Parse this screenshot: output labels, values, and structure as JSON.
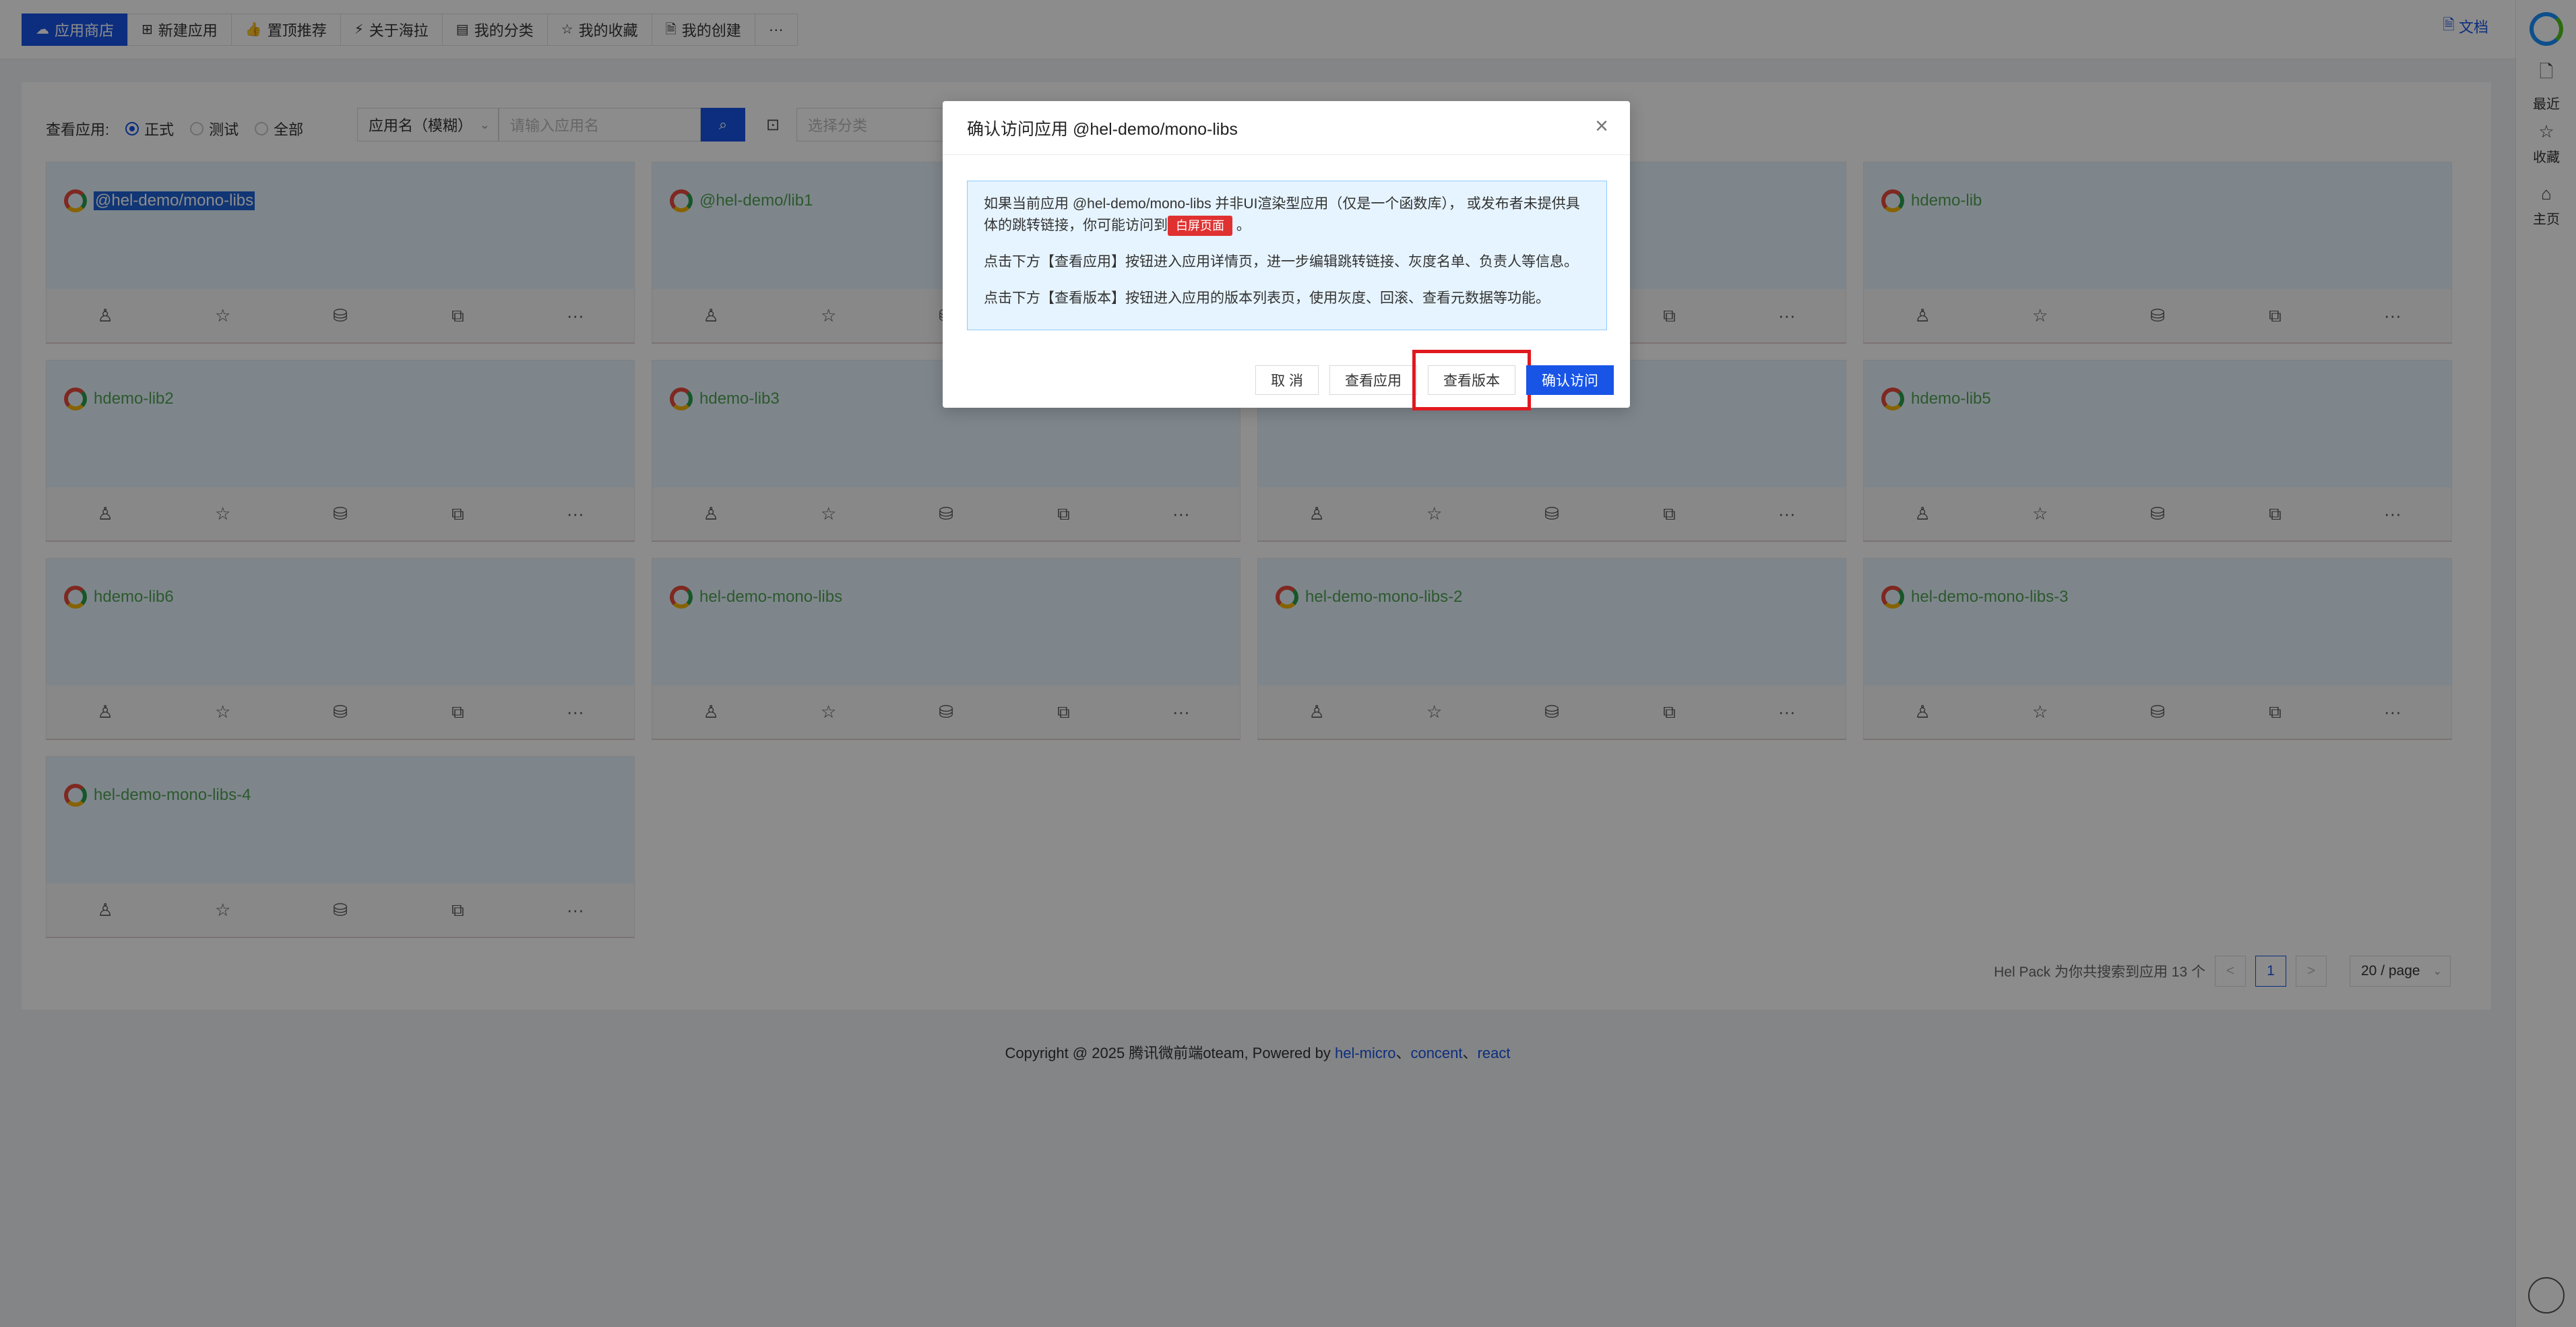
{
  "topnav": {
    "items": [
      {
        "label": "应用商店",
        "icon": "cloud-icon",
        "glyph": "☁",
        "active": true
      },
      {
        "label": "新建应用",
        "icon": "plus-square-icon",
        "glyph": "⊞"
      },
      {
        "label": "置顶推荐",
        "icon": "thumbs-up-icon",
        "glyph": "👍"
      },
      {
        "label": "关于海拉",
        "icon": "lightning-icon",
        "glyph": "⚡"
      },
      {
        "label": "我的分类",
        "icon": "list-icon",
        "glyph": "▤"
      },
      {
        "label": "我的收藏",
        "icon": "star-icon",
        "glyph": "☆"
      },
      {
        "label": "我的创建",
        "icon": "file-icon",
        "glyph": "🗎"
      },
      {
        "label": "···",
        "icon": "more-icon",
        "glyph": ""
      }
    ],
    "doc_label": "文档"
  },
  "right_sidebar": {
    "items": [
      {
        "label": "最近",
        "icon": "file-icon",
        "glyph": "🗋"
      },
      {
        "label": "收藏",
        "icon": "star-icon",
        "glyph": "☆"
      },
      {
        "label": "主页",
        "icon": "home-icon",
        "glyph": "⌂"
      }
    ]
  },
  "filters": {
    "label": "查看应用:",
    "options": [
      "正式",
      "测试",
      "全部"
    ],
    "selected": "正式",
    "type_select": "应用名（模糊）",
    "search_placeholder": "请输入应用名",
    "category_placeholder": "选择分类"
  },
  "cards": [
    {
      "name": "@hel-demo/mono-libs",
      "selected": true
    },
    {
      "name": "@hel-demo/lib1"
    },
    {
      "name": ""
    },
    {
      "name": "hdemo-lib"
    },
    {
      "name": "hdemo-lib2"
    },
    {
      "name": "hdemo-lib3"
    },
    {
      "name": ""
    },
    {
      "name": "hdemo-lib5"
    },
    {
      "name": "hdemo-lib6"
    },
    {
      "name": "hel-demo-mono-libs"
    },
    {
      "name": "hel-demo-mono-libs-2"
    },
    {
      "name": "hel-demo-mono-libs-3"
    },
    {
      "name": "hel-demo-mono-libs-4"
    }
  ],
  "card_actions": [
    "avatar",
    "☆",
    "⛁",
    "⧉",
    "···"
  ],
  "pagination": {
    "summary": "Hel Pack 为你共搜索到应用 13 个",
    "prev": "<",
    "current": "1",
    "next": ">",
    "page_size": "20 / page"
  },
  "footer": {
    "prefix": "Copyright @ 2025 腾讯微前端oteam, Powered by ",
    "links": [
      "hel-micro",
      "concent",
      "react"
    ],
    "sep": "、"
  },
  "modal": {
    "title": "确认访问应用 @hel-demo/mono-libs",
    "line1_a": "如果当前应用 @hel-demo/mono-libs 并非UI渲染型应用（仅是一个函数库），  或发布者未提供具体的跳转链接，你可能访问到",
    "blank_tag": "白屏页面",
    "line1_b": " 。",
    "line2": "点击下方【查看应用】按钮进入应用详情页，进一步编辑跳转链接、灰度名单、负责人等信息。",
    "line3": "点击下方【查看版本】按钮进入应用的版本列表页，使用灰度、回滚、查看元数据等功能。",
    "buttons": {
      "cancel": "取 消",
      "view_app": "查看应用",
      "view_version": "查看版本",
      "confirm": "确认访问"
    }
  }
}
